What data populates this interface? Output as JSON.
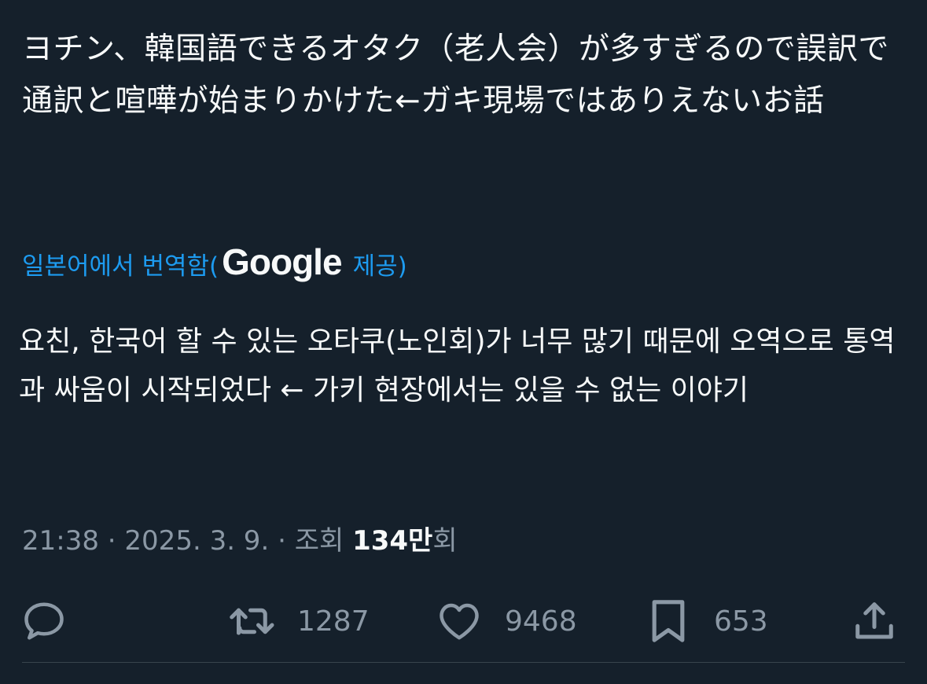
{
  "tweet": {
    "original_text": "ヨチン、韓国語できるオタク（老人会）が多すぎるので誤訳で通訳と喧嘩が始まりかけた←ガキ現場ではありえないお話",
    "translation": {
      "prefix": "일본어에서 번역함(",
      "brand": "Google",
      "suffix": "제공)"
    },
    "translated_text": "요친, 한국어 할 수 있는 오타쿠(노인회)가 너무 많기 때문에 오역으로 통역과 싸움이 시작되었다 ← 가키 현장에서는 있을 수 없는 이야기",
    "meta": {
      "time": "21:38",
      "separator1": " · ",
      "date": "2025. 3. 9.",
      "separator2": " · ",
      "views_label": "조회 ",
      "views_count": "134만",
      "views_suffix": "회"
    },
    "actions": {
      "reply": {
        "icon": "reply-icon"
      },
      "retweet": {
        "icon": "retweet-icon",
        "count": "1287"
      },
      "like": {
        "icon": "heart-icon",
        "count": "9468"
      },
      "bookmark": {
        "icon": "bookmark-icon",
        "count": "653"
      },
      "share": {
        "icon": "share-icon"
      }
    }
  },
  "colors": {
    "background": "#15202b",
    "text": "#f7f9f9",
    "secondary": "#8b98a5",
    "link": "#1d9bf0",
    "divider": "#38444d"
  }
}
